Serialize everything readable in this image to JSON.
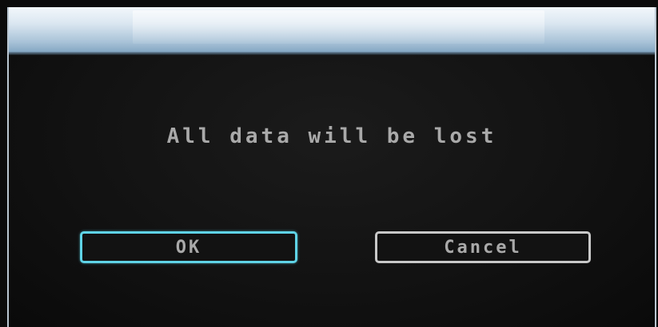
{
  "dialog": {
    "message": "All data will be lost",
    "buttons": {
      "ok_label": "OK",
      "cancel_label": "Cancel"
    }
  },
  "colors": {
    "focus_border": "#5fd3e6",
    "button_border": "#c8c8c8",
    "text": "#a9a9a9",
    "title_bar_top": "#f2f7fb",
    "title_bar_bottom": "#7fa3c0",
    "background": "#121212"
  }
}
